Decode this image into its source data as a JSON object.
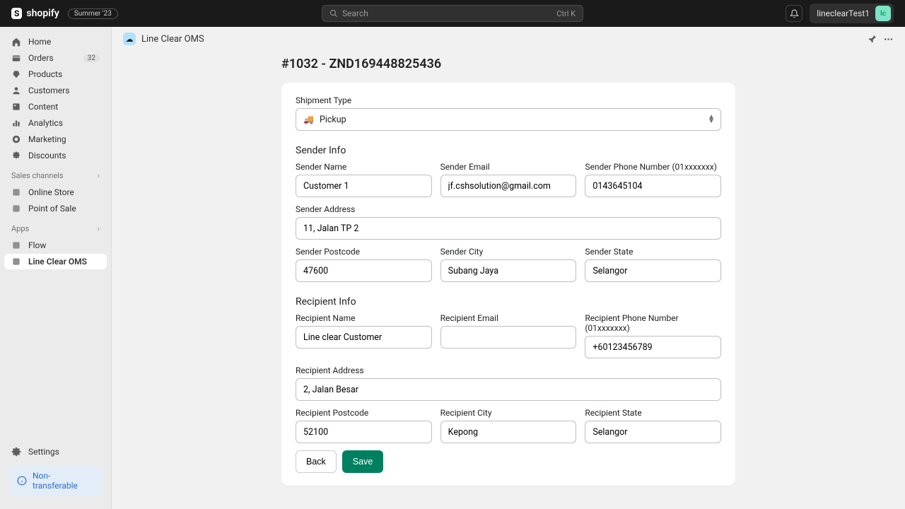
{
  "topbar": {
    "brand": "shopify",
    "edition": "Summer '23",
    "search_placeholder": "Search",
    "search_kbd": "Ctrl K",
    "username": "lineclearTest1",
    "avatar_initials": "lc"
  },
  "sidebar": {
    "items": [
      {
        "label": "Home"
      },
      {
        "label": "Orders",
        "badge": "32"
      },
      {
        "label": "Products"
      },
      {
        "label": "Customers"
      },
      {
        "label": "Content"
      },
      {
        "label": "Analytics"
      },
      {
        "label": "Marketing"
      },
      {
        "label": "Discounts"
      }
    ],
    "section_channels": "Sales channels",
    "channels": [
      {
        "label": "Online Store"
      },
      {
        "label": "Point of Sale"
      }
    ],
    "section_apps": "Apps",
    "apps": [
      {
        "label": "Flow"
      },
      {
        "label": "Line Clear OMS"
      }
    ],
    "settings": "Settings",
    "nontransferable": "Non-transferable"
  },
  "page": {
    "app_title": "Line Clear OMS",
    "title": "#1032 - ZND169448825436"
  },
  "form": {
    "shipment_type_label": "Shipment Type",
    "shipment_type_value": "Pickup",
    "sender_section": "Sender Info",
    "sender_name_label": "Sender Name",
    "sender_name": "Customer 1",
    "sender_email_label": "Sender Email",
    "sender_email": "jf.cshsolution@gmail.com",
    "sender_phone_label": "Sender Phone Number (01xxxxxxx)",
    "sender_phone": "0143645104",
    "sender_address_label": "Sender Address",
    "sender_address": "11, Jalan TP 2",
    "sender_postcode_label": "Sender Postcode",
    "sender_postcode": "47600",
    "sender_city_label": "Sender City",
    "sender_city": "Subang Jaya",
    "sender_state_label": "Sender State",
    "sender_state": "Selangor",
    "recipient_section": "Recipient Info",
    "recipient_name_label": "Recipient Name",
    "recipient_name": "Line clear Customer",
    "recipient_email_label": "Recipient Email",
    "recipient_email": "",
    "recipient_phone_label": "Recipient Phone Number (01xxxxxxx)",
    "recipient_phone": "+60123456789",
    "recipient_address_label": "Recipient Address",
    "recipient_address": "2, Jalan Besar",
    "recipient_postcode_label": "Recipient Postcode",
    "recipient_postcode": "52100",
    "recipient_city_label": "Recipient City",
    "recipient_city": "Kepong",
    "recipient_state_label": "Recipient State",
    "recipient_state": "Selangor",
    "back": "Back",
    "save": "Save"
  }
}
